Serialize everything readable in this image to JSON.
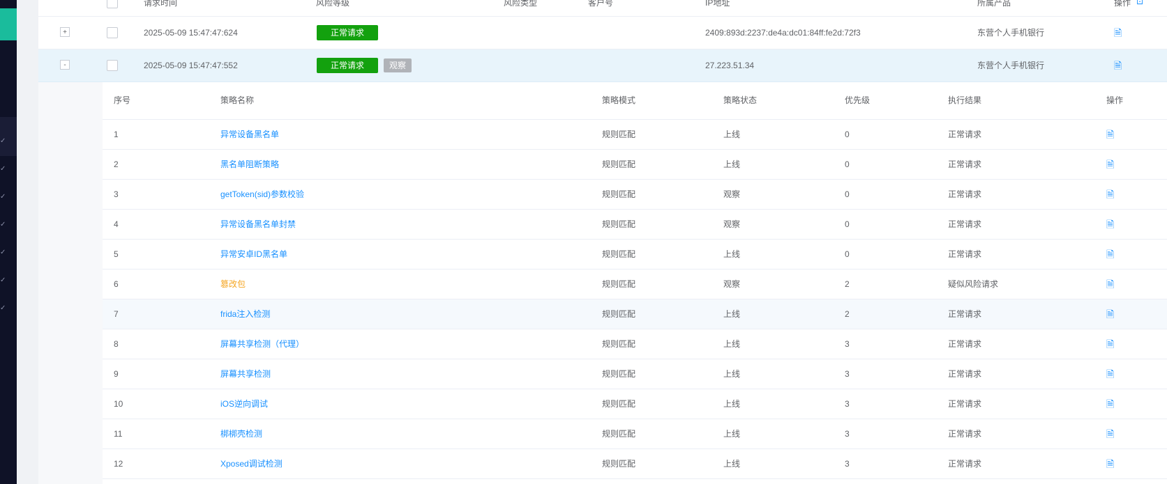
{
  "main_table": {
    "headers": [
      "请求时间",
      "风险等级",
      "风险类型",
      "客户号",
      "IP地址",
      "所属产品",
      "操作"
    ],
    "rows": [
      {
        "expand": "+",
        "time": "2025-05-09 15:47:47:624",
        "risk_level": "正常请求",
        "ip": "2409:893d:2237:de4a:dc01:84ff:fe2d:72f3",
        "product": "东营个人手机银行"
      },
      {
        "expand": "-",
        "time": "2025-05-09 15:47:47:552",
        "risk_level": "正常请求",
        "extra_tag": "观察",
        "ip": "27.223.51.34",
        "product": "东营个人手机银行"
      }
    ]
  },
  "sub_table": {
    "headers": [
      "序号",
      "策略名称",
      "策略模式",
      "策略状态",
      "优先级",
      "执行结果",
      "操作"
    ],
    "rows": [
      {
        "idx": "1",
        "name": "异常设备黑名单",
        "mode": "规则匹配",
        "status": "上线",
        "priority": "0",
        "result": "正常请求",
        "name_color": "blue"
      },
      {
        "idx": "2",
        "name": "黑名单阻断策略",
        "mode": "规则匹配",
        "status": "上线",
        "priority": "0",
        "result": "正常请求",
        "name_color": "blue"
      },
      {
        "idx": "3",
        "name": "getToken(sid)参数校验",
        "mode": "规则匹配",
        "status": "观察",
        "priority": "0",
        "result": "正常请求",
        "name_color": "blue"
      },
      {
        "idx": "4",
        "name": "异常设备黑名单封禁",
        "mode": "规则匹配",
        "status": "观察",
        "priority": "0",
        "result": "正常请求",
        "name_color": "blue"
      },
      {
        "idx": "5",
        "name": "异常安卓ID黑名单",
        "mode": "规则匹配",
        "status": "上线",
        "priority": "0",
        "result": "正常请求",
        "name_color": "blue"
      },
      {
        "idx": "6",
        "name": "篡改包",
        "mode": "规则匹配",
        "status": "观察",
        "priority": "2",
        "result": "疑似风险请求",
        "name_color": "orange"
      },
      {
        "idx": "7",
        "name": "frida注入检测",
        "mode": "规则匹配",
        "status": "上线",
        "priority": "2",
        "result": "正常请求",
        "name_color": "blue",
        "highlight": true
      },
      {
        "idx": "8",
        "name": "屏幕共享检测（代理）",
        "mode": "规则匹配",
        "status": "上线",
        "priority": "3",
        "result": "正常请求",
        "name_color": "blue"
      },
      {
        "idx": "9",
        "name": "屏幕共享检测",
        "mode": "规则匹配",
        "status": "上线",
        "priority": "3",
        "result": "正常请求",
        "name_color": "blue"
      },
      {
        "idx": "10",
        "name": "iOS逆向调试",
        "mode": "规则匹配",
        "status": "上线",
        "priority": "3",
        "result": "正常请求",
        "name_color": "blue"
      },
      {
        "idx": "11",
        "name": "梆梆壳检测",
        "mode": "规则匹配",
        "status": "上线",
        "priority": "3",
        "result": "正常请求",
        "name_color": "blue"
      },
      {
        "idx": "12",
        "name": "Xposed调试检测",
        "mode": "规则匹配",
        "status": "上线",
        "priority": "3",
        "result": "正常请求",
        "name_color": "blue"
      }
    ]
  },
  "colors": {
    "sidebar_bg": "#0f1227",
    "sidebar_accent": "#1abc9c",
    "tag_green": "#13a10e",
    "tag_gray": "#b0b3b8",
    "link_blue": "#1890ff",
    "link_orange": "#f5a623",
    "expanded_row_bg": "#e8f4fb"
  },
  "icons": {
    "row_action": "document-icon",
    "sidebar_chevron": "chevron-down-icon"
  }
}
